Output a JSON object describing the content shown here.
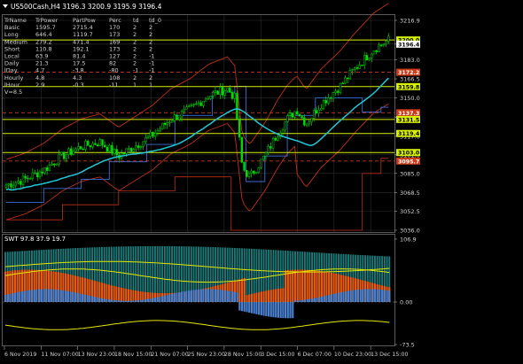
{
  "window": {
    "title": "US500Cash,H4  3196.3 3200.9 3195.9 3196.4"
  },
  "table": {
    "headers": [
      "TrName",
      "TrPower",
      "PartPow",
      "Perc",
      "td",
      "td_0"
    ],
    "rows": [
      [
        "Basic",
        "1595.7",
        "2715.4",
        "170",
        "2",
        "2"
      ],
      [
        "Long",
        "646.4",
        "1119.7",
        "173",
        "2",
        "2"
      ],
      [
        "Medium",
        "279.2",
        "471.4",
        "169",
        "2",
        "2"
      ],
      [
        "Short",
        "110.8",
        "192.1",
        "173",
        "2",
        "2"
      ],
      [
        "Local",
        "63.9",
        "81.4",
        "127",
        "2",
        "-1"
      ],
      [
        "Daily",
        "21.3",
        "17.5",
        "82",
        "2",
        "-1"
      ],
      [
        "lDay",
        "4.7",
        "-3.8",
        "-80",
        "-1",
        "-1"
      ],
      [
        "Hourly",
        "4.8",
        "4.3",
        "108",
        "2",
        "2"
      ],
      [
        "lHour",
        "2.9",
        "-0.3",
        "-11",
        "1",
        "1"
      ]
    ],
    "footer": "V=8.5"
  },
  "price_axis": {
    "ticks": [
      {
        "label": "3216.9",
        "value": 3216.9
      },
      {
        "label": "3196.4",
        "value": 3196.4
      },
      {
        "label": "3183.0",
        "value": 3183.0
      },
      {
        "label": "3166.5",
        "value": 3166.5
      },
      {
        "label": "3150.0",
        "value": 3150.0
      },
      {
        "label": "3133.5",
        "value": 3133.5
      },
      {
        "label": "3117.0",
        "value": 3117.0
      },
      {
        "label": "3101.0",
        "value": 3101.0
      },
      {
        "label": "3085.0",
        "value": 3085.0
      },
      {
        "label": "3068.5",
        "value": 3068.5
      },
      {
        "label": "3052.5",
        "value": 3052.5
      },
      {
        "label": "3036.0",
        "value": 3036.0
      }
    ],
    "badges": [
      {
        "label": "3200.0",
        "value": 3200.0,
        "bg": "#d7f000",
        "fg": "#000000"
      },
      {
        "label": "3196.4",
        "value": 3196.4,
        "bg": "#ffffff",
        "fg": "#000000"
      },
      {
        "label": "3172.2",
        "value": 3172.2,
        "bg": "#c83a18",
        "fg": "#ffffff"
      },
      {
        "label": "3159.8",
        "value": 3159.8,
        "bg": "#d7f000",
        "fg": "#000000"
      },
      {
        "label": "3137.3",
        "value": 3137.3,
        "bg": "#c83a18",
        "fg": "#ffffff"
      },
      {
        "label": "3131.5",
        "value": 3131.5,
        "bg": "#d7f000",
        "fg": "#000000"
      },
      {
        "label": "3119.4",
        "value": 3119.4,
        "bg": "#d7f000",
        "fg": "#000000"
      },
      {
        "label": "3103.0",
        "value": 3103.0,
        "bg": "#d7f000",
        "fg": "#000000"
      },
      {
        "label": "3095.7",
        "value": 3095.7,
        "bg": "#c83a18",
        "fg": "#ffffff"
      }
    ]
  },
  "indicator": {
    "title": "SWT 97.8 37.9 19.7",
    "ticks": [
      {
        "label": "106.9",
        "value": 106.9
      },
      {
        "label": "0.00",
        "value": 0.0
      },
      {
        "label": "-73.5",
        "value": -73.5
      }
    ]
  },
  "time_axis": {
    "labels": [
      "6 Nov 2019",
      "11 Nov 07:00",
      "13 Nov 23:00",
      "18 Nov 15:00",
      "21 Nov 07:00",
      "25 Nov 23:00",
      "28 Nov 15:00",
      "3 Dec 15:00",
      "6 Dec 07:00",
      "10 Dec 23:00",
      "13 Dec 15:00"
    ]
  },
  "colors": {
    "background": "#000000",
    "grid": "#2e2e2e",
    "candles": "#00dd00",
    "ma_cyan": "#20c8d8",
    "envelope_red": "#c03018",
    "step_blue": "#3a6ed8",
    "level_yellow": "#d7f000",
    "level_red": "#c83a18",
    "osc_orange": "#e85a10",
    "osc_blue": "#4a80d0",
    "osc_teal": "#1a7a7a",
    "osc_yellow": "#e8e800"
  }
}
